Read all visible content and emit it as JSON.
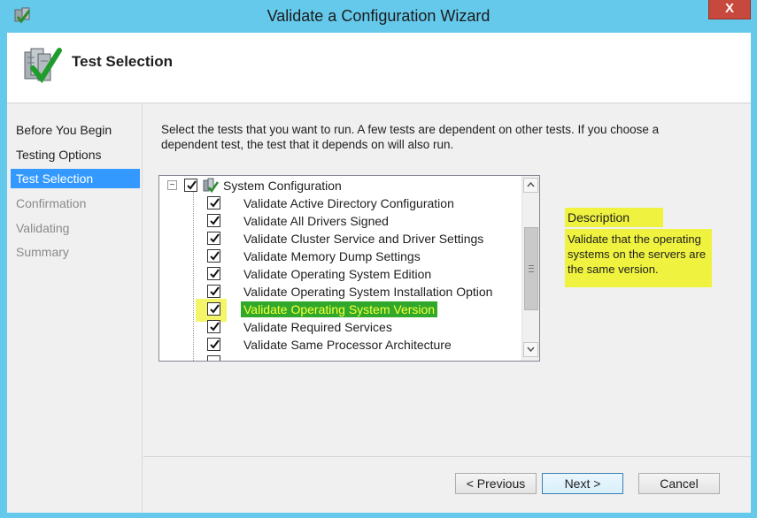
{
  "window": {
    "title": "Validate a Configuration Wizard",
    "close_label": "X"
  },
  "header": {
    "title": "Test Selection"
  },
  "nav": {
    "items": [
      {
        "label": "Before You Begin",
        "state": "normal"
      },
      {
        "label": "Testing Options",
        "state": "normal"
      },
      {
        "label": "Test Selection",
        "state": "selected"
      },
      {
        "label": "Confirmation",
        "state": "disabled"
      },
      {
        "label": "Validating",
        "state": "disabled"
      },
      {
        "label": "Summary",
        "state": "disabled"
      }
    ]
  },
  "main": {
    "instructions": "Select the tests that you want to run.  A few tests are dependent on other tests.  If you choose a dependent test, the test that it depends on will also run.",
    "tree": {
      "root": {
        "label": "System Configuration",
        "checked": true,
        "expander": "−"
      },
      "items": [
        {
          "label": "Validate Active Directory Configuration",
          "checked": true
        },
        {
          "label": "Validate All Drivers Signed",
          "checked": true
        },
        {
          "label": "Validate Cluster Service and Driver Settings",
          "checked": true
        },
        {
          "label": "Validate Memory Dump Settings",
          "checked": true
        },
        {
          "label": "Validate Operating System Edition",
          "checked": true
        },
        {
          "label": "Validate Operating System Installation Option",
          "checked": true
        },
        {
          "label": "Validate Operating System Version",
          "checked": true,
          "selected": true
        },
        {
          "label": "Validate Required Services",
          "checked": true
        },
        {
          "label": "Validate Same Processor Architecture",
          "checked": true
        }
      ]
    },
    "description": {
      "title": "Description",
      "text": "Validate that the operating systems on the servers are the same version."
    }
  },
  "footer": {
    "previous_label": "< Previous",
    "next_label": "Next >",
    "cancel_label": "Cancel"
  },
  "colors": {
    "titlebar": "#65c9ec",
    "selection": "#3399ff",
    "highlight_yellow": "#eff23f",
    "highlight_green": "#2fa82b"
  },
  "icons": [
    "wizard-app-icon",
    "test-selection-checklist-icon",
    "server-group-icon",
    "checkmark-icon",
    "chevron-up-icon",
    "chevron-down-icon"
  ]
}
